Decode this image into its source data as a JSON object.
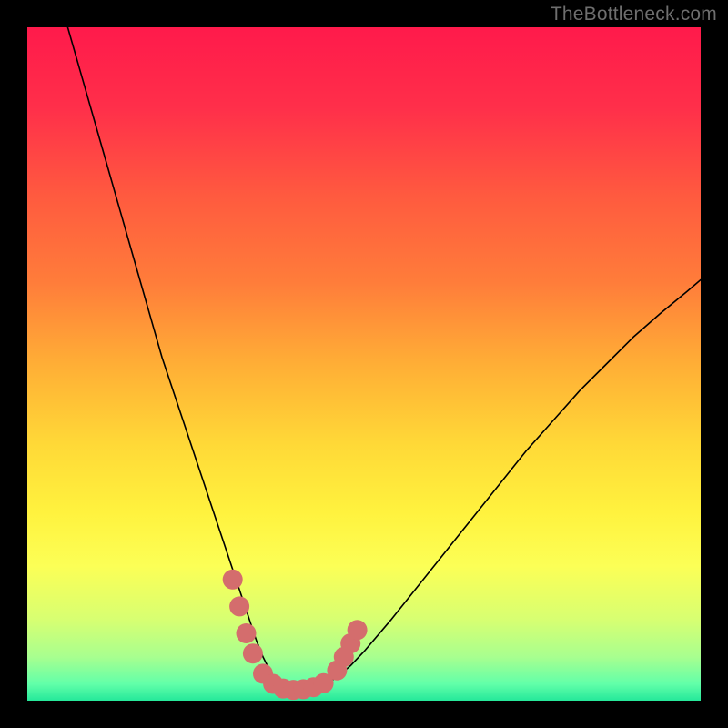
{
  "watermark_text": "TheBottleneck.com",
  "chart_data": {
    "type": "line",
    "title": "",
    "xlabel": "",
    "ylabel": "",
    "xlim": [
      0,
      100
    ],
    "ylim": [
      0,
      100
    ],
    "grid": false,
    "legend": false,
    "background_gradient_stops": [
      {
        "offset": 0.0,
        "color": "#ff1a4b"
      },
      {
        "offset": 0.12,
        "color": "#ff2f4a"
      },
      {
        "offset": 0.25,
        "color": "#ff5a3f"
      },
      {
        "offset": 0.38,
        "color": "#ff7d3a"
      },
      {
        "offset": 0.5,
        "color": "#ffae36"
      },
      {
        "offset": 0.62,
        "color": "#ffd937"
      },
      {
        "offset": 0.72,
        "color": "#fff23e"
      },
      {
        "offset": 0.8,
        "color": "#fcff56"
      },
      {
        "offset": 0.88,
        "color": "#d7ff72"
      },
      {
        "offset": 0.935,
        "color": "#a8ff8f"
      },
      {
        "offset": 0.975,
        "color": "#62ffa9"
      },
      {
        "offset": 1.0,
        "color": "#25e89a"
      }
    ],
    "series": [
      {
        "name": "bottleneck-curve",
        "stroke": "#000000",
        "stroke_width": 1.6,
        "x": [
          6,
          8,
          10,
          12,
          14,
          16,
          18,
          20,
          22,
          24,
          26,
          28,
          29,
          30,
          31,
          32,
          33,
          34,
          35,
          36,
          37,
          38,
          40,
          42,
          44,
          46,
          48,
          50,
          54,
          58,
          62,
          66,
          70,
          74,
          78,
          82,
          86,
          90,
          94,
          98,
          100
        ],
        "y": [
          100,
          93,
          86,
          79,
          72,
          65,
          58,
          51,
          45,
          39,
          33,
          27,
          24,
          21,
          18,
          15,
          12,
          9,
          6.5,
          4.5,
          3,
          2,
          1.5,
          1.7,
          2.3,
          3.5,
          5.2,
          7.3,
          12,
          17,
          22,
          27,
          32,
          37,
          41.5,
          46,
          50,
          54,
          57.5,
          60.8,
          62.5
        ]
      }
    ],
    "markers": {
      "name": "highlight-dots",
      "fill": "#d46d6d",
      "radius": 11,
      "points": [
        {
          "x": 30.5,
          "y": 18
        },
        {
          "x": 31.5,
          "y": 14
        },
        {
          "x": 32.5,
          "y": 10
        },
        {
          "x": 33.5,
          "y": 7
        },
        {
          "x": 35,
          "y": 4
        },
        {
          "x": 36.5,
          "y": 2.5
        },
        {
          "x": 38,
          "y": 1.8
        },
        {
          "x": 39.5,
          "y": 1.6
        },
        {
          "x": 41,
          "y": 1.7
        },
        {
          "x": 42.5,
          "y": 2.0
        },
        {
          "x": 44,
          "y": 2.6
        },
        {
          "x": 46,
          "y": 4.5
        },
        {
          "x": 47,
          "y": 6.5
        },
        {
          "x": 48,
          "y": 8.5
        },
        {
          "x": 49,
          "y": 10.5
        }
      ]
    }
  }
}
